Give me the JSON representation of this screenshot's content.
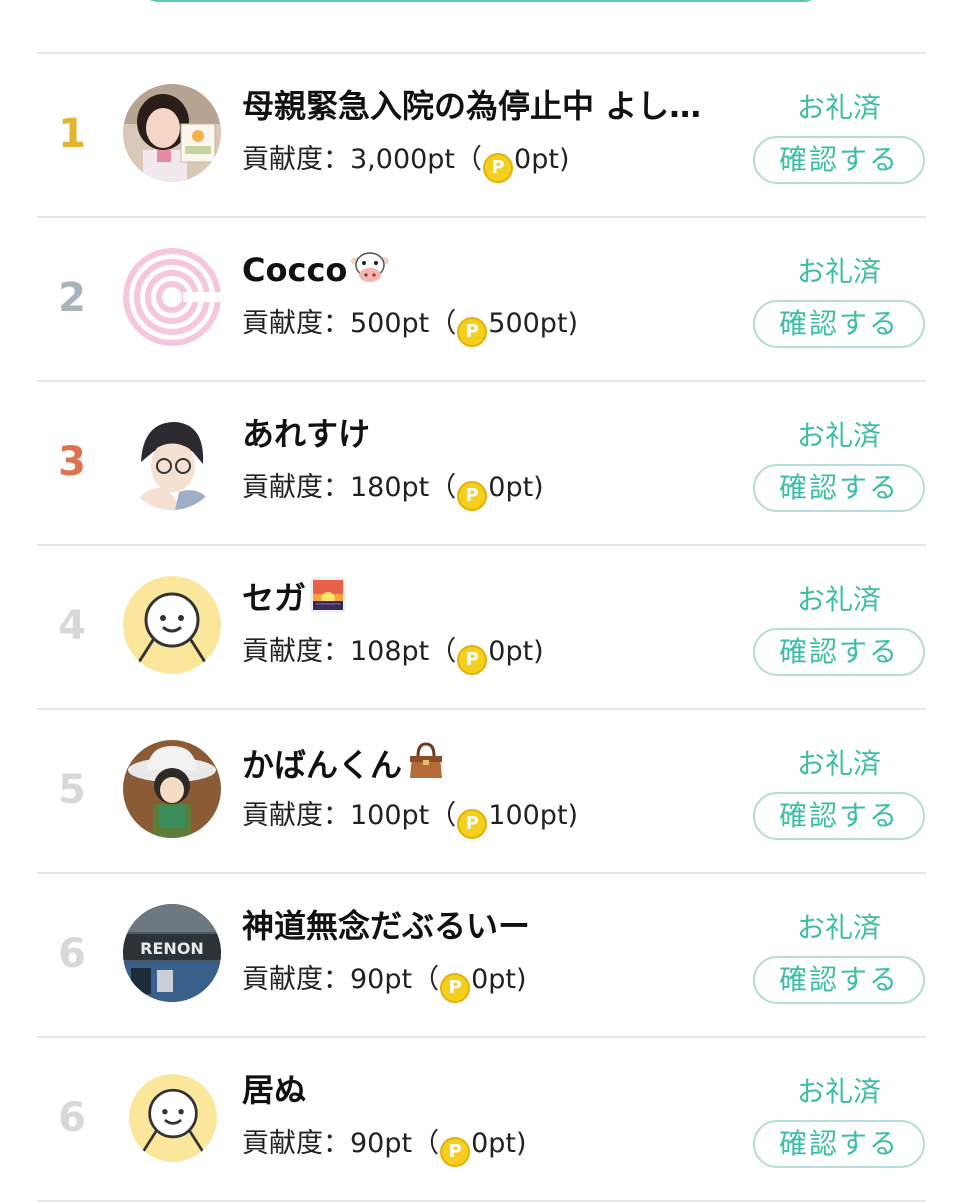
{
  "colors": {
    "accent": "#3dbda6",
    "rank1": "#e3b52e",
    "rank2": "#a8b4bc",
    "rank3": "#e0724f",
    "rank_other": "#d8d8d8"
  },
  "labels": {
    "score_prefix": "貢献度：",
    "coin_symbol": "P",
    "thanks_status": "お礼済",
    "confirm_button": "確認する"
  },
  "rows": [
    {
      "rank": "1",
      "name": "母親緊急入院の為停止中 よし…",
      "emoji": "",
      "score": "3,000pt",
      "points": "0pt",
      "avatar": "photo-girl"
    },
    {
      "rank": "2",
      "name": "Cocco",
      "emoji": "cow-face-emoji",
      "score": "500pt",
      "points": "500pt",
      "avatar": "pink-spiral"
    },
    {
      "rank": "3",
      "name": "あれすけ",
      "emoji": "",
      "score": "180pt",
      "points": "0pt",
      "avatar": "anime-man"
    },
    {
      "rank": "4",
      "name": "セガ",
      "emoji": "sunrise-emoji",
      "score": "108pt",
      "points": "0pt",
      "avatar": "default-face"
    },
    {
      "rank": "5",
      "name": "かばんくん",
      "emoji": "handbag-emoji",
      "score": "100pt",
      "points": "100pt",
      "avatar": "anime-hat"
    },
    {
      "rank": "6",
      "name": "神道無念だぶるいー",
      "emoji": "",
      "score": "90pt",
      "points": "0pt",
      "avatar": "renon-sign"
    },
    {
      "rank": "6",
      "name": "居ぬ",
      "emoji": "",
      "score": "90pt",
      "points": "0pt",
      "avatar": "default-face"
    }
  ]
}
